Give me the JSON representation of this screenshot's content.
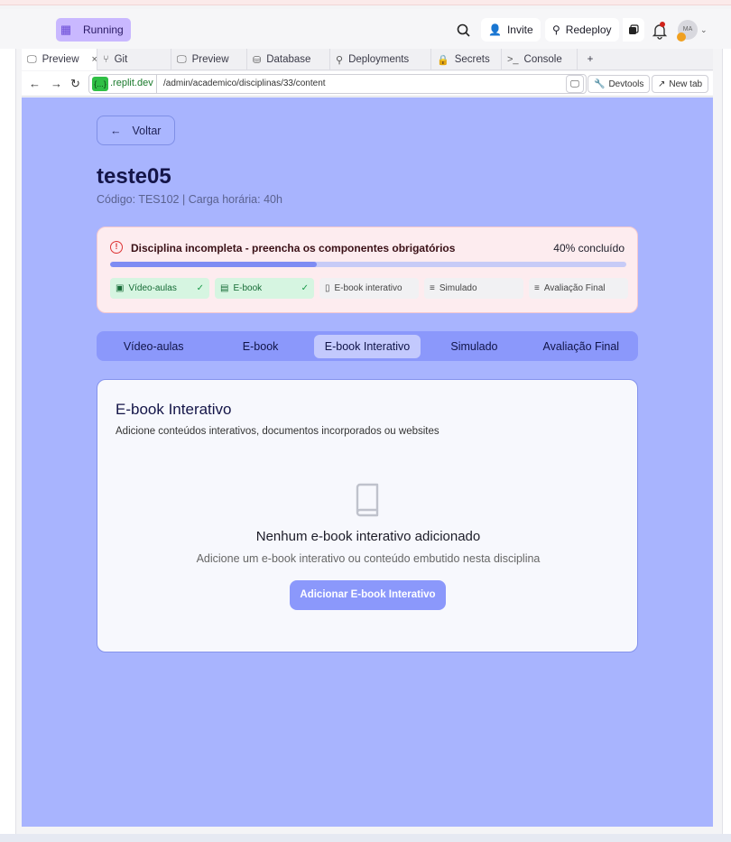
{
  "topbar": {
    "run_label": "Running",
    "invite_label": "Invite",
    "redeploy_label": "Redeploy",
    "avatar_initials": "MA"
  },
  "browser_tabs": [
    {
      "label": "Preview",
      "icon": "monitor-icon",
      "active": true
    },
    {
      "label": "Git",
      "icon": "git-icon"
    },
    {
      "label": "Preview",
      "icon": "monitor-icon"
    },
    {
      "label": "Database",
      "icon": "database-icon"
    },
    {
      "label": "Deployments",
      "icon": "deploy-icon"
    },
    {
      "label": "Secrets",
      "icon": "lock-icon"
    },
    {
      "label": "Console",
      "icon": "terminal-icon"
    }
  ],
  "address": {
    "pill": "{...}",
    "host": ".replit.dev",
    "path": "/admin/academico/disciplinas/33/content",
    "devtools_label": "Devtools",
    "newtab_label": "New tab"
  },
  "page": {
    "back_label": "Voltar",
    "title": "teste05",
    "subtitle": "Código: TES102 | Carga horária: 40h"
  },
  "alert": {
    "message": "Disciplina incompleta - preencha os componentes obrigatórios",
    "percent_label": "40% concluído",
    "progress": 0.4,
    "components": [
      {
        "label": "Vídeo-aulas",
        "done": true,
        "icon": "video-icon"
      },
      {
        "label": "E-book",
        "done": true,
        "icon": "file-icon"
      },
      {
        "label": "E-book interativo",
        "done": false,
        "icon": "book-icon"
      },
      {
        "label": "Simulado",
        "done": false,
        "icon": "list-icon"
      },
      {
        "label": "Avaliação Final",
        "done": false,
        "icon": "list-icon"
      }
    ]
  },
  "tabs": [
    {
      "label": "Vídeo-aulas"
    },
    {
      "label": "E-book"
    },
    {
      "label": "E-book Interativo",
      "active": true
    },
    {
      "label": "Simulado"
    },
    {
      "label": "Avaliação Final"
    }
  ],
  "card": {
    "title": "E-book Interativo",
    "subtitle": "Adicione conteúdos interativos, documentos incorporados ou websites",
    "empty_title": "Nenhum e-book interativo adicionado",
    "empty_subtitle": "Adicione um e-book interativo ou conteúdo embutido nesta disciplina",
    "button_label": "Adicionar E-book Interativo"
  }
}
